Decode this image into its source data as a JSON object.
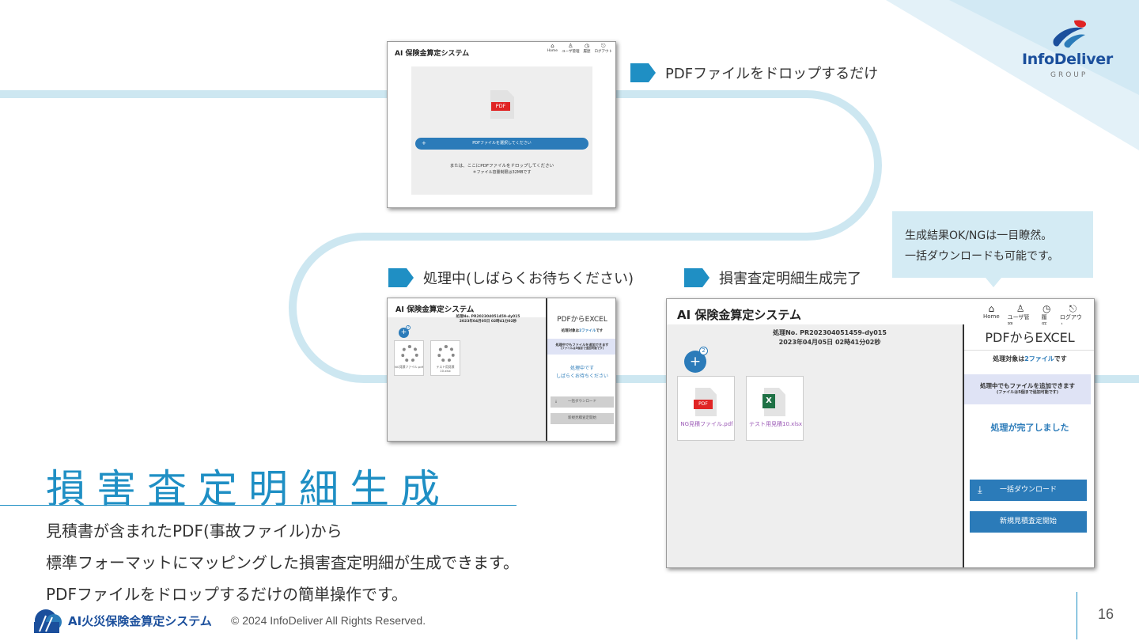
{
  "company": {
    "name": "InfoDeliver",
    "group": "GROUP"
  },
  "steps": {
    "step1": "PDFファイルをドロップするだけ",
    "step2": "処理中(しばらくお待ちください)",
    "step3": "損害査定明細生成完了"
  },
  "callout": {
    "line1": "生成結果OK/NGは一目瞭然。",
    "line2": "一括ダウンロードも可能です。"
  },
  "app": {
    "title": "AI 保険金算定システム",
    "nav": [
      "Home",
      "ユーザ管理",
      "履歴",
      "ログアウト"
    ]
  },
  "upload": {
    "pdf_label": "PDF",
    "select_button": "PDFファイルを選択してください",
    "drop_hint": "または、ここにPDFファイルをドロップしてください",
    "size_limit": "＊ファイル容量制限は32MBです"
  },
  "processing": {
    "proc_no": "処理No. PR202304051459-dy015",
    "proc_date": "2023年04月05日 02時41分02秒",
    "badge": "2",
    "files": [
      "NG見積ファイル.pdf",
      "テスト用見積10.xlsx"
    ],
    "panel_title": "PDFからEXCEL",
    "target_prefix": "処理対象は",
    "target_count": "2ファイル",
    "target_suffix": "です",
    "addable": "処理中でもファイルを追加できます",
    "addable_note": "(ファイルは5個まで追加可能です)",
    "in_progress_1": "処理中です",
    "in_progress_2": "しばらくお待ちください",
    "done": "処理が完了しました",
    "download_button": "一括ダウンロード",
    "new_button": "新規見積査定開始"
  },
  "headline": "損害査定明細生成",
  "body": [
    "見積書が含まれたPDF(事故ファイル)から",
    "標準フォーマットにマッピングした損害査定明細が生成できます。",
    "PDFファイルをドロップするだけの簡単操作です。"
  ],
  "footer": {
    "product": "AI火災保険金算定システム",
    "copyright": "© 2024 InfoDeliver All Rights Reserved.",
    "page": "16"
  },
  "icons": {
    "home": "home-icon",
    "users": "user-icon",
    "history": "clock-icon",
    "logout": "logout-icon",
    "download": "download-icon"
  },
  "colors": {
    "accent": "#1f8fc4",
    "button": "#2b7bb9",
    "brand": "#1b4f9c"
  }
}
